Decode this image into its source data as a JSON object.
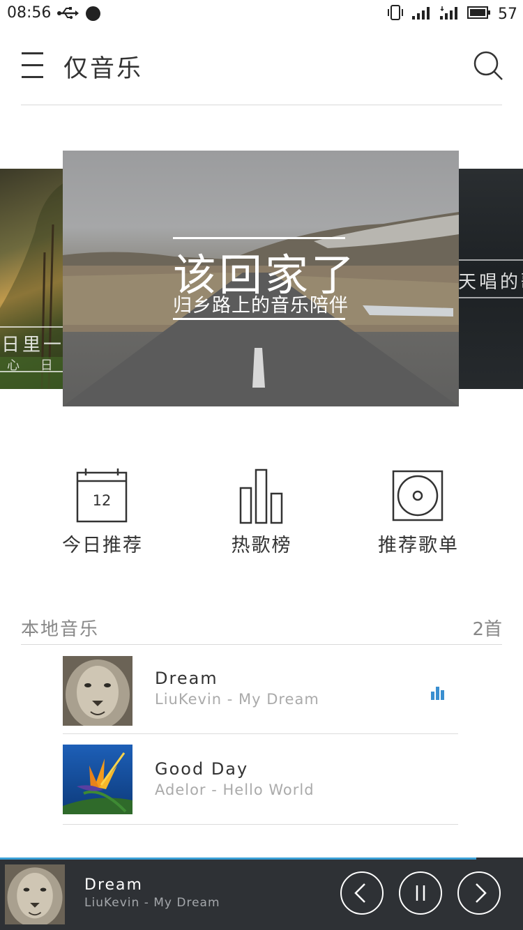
{
  "status_bar": {
    "time": "08:56",
    "battery": "57"
  },
  "header": {
    "title": "仅音乐"
  },
  "carousel": {
    "main": {
      "title": "该回家了",
      "subtitle": "归乡路上的音乐陪伴"
    },
    "left": {
      "title": "日里一",
      "subtitle": "心 日 语"
    },
    "right": {
      "title": "天唱的歌"
    }
  },
  "entries": [
    {
      "label": "今日推荐",
      "date": "12"
    },
    {
      "label": "热歌榜"
    },
    {
      "label": "推荐歌单"
    }
  ],
  "local_music": {
    "title": "本地音乐",
    "count": "2首",
    "songs": [
      {
        "name": "Dream",
        "meta": "LiuKevin - My Dream"
      },
      {
        "name": "Good Day",
        "meta": "Adelor - Hello World"
      }
    ]
  },
  "player": {
    "name": "Dream",
    "meta": "LiuKevin - My Dream",
    "progress": 0.91
  },
  "colors": {
    "accent": "#3aa0d6",
    "player_bg": "#2e3135"
  }
}
